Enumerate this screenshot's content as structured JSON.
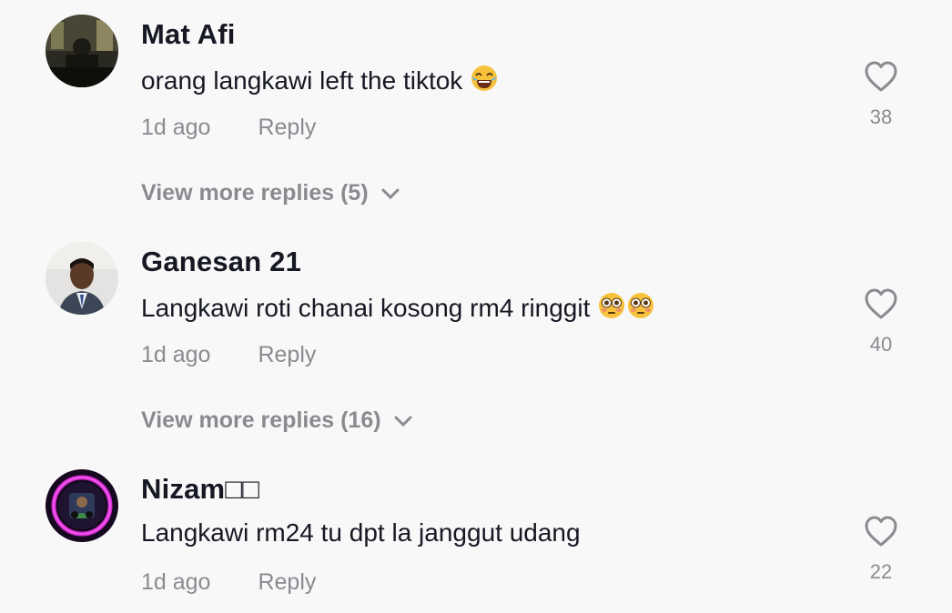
{
  "comments": [
    {
      "username": "Mat Afi",
      "text": "orang langkawi left the tiktok ",
      "emoji": [
        "tears-of-joy"
      ],
      "time": "1d ago",
      "reply_label": "Reply",
      "likes": "38",
      "more_replies": "View more replies (5)"
    },
    {
      "username": "Ganesan 21",
      "text": "Langkawi roti chanai kosong rm4 ringgit ",
      "emoji": [
        "flushed",
        "flushed"
      ],
      "time": "1d ago",
      "reply_label": "Reply",
      "likes": "40",
      "more_replies": "View more replies (16)"
    },
    {
      "username": "Nizam",
      "username_suffix": "□□",
      "text": "Langkawi rm24 tu dpt la janggut udang",
      "time": "1d ago",
      "reply_label": "Reply",
      "likes": "22"
    }
  ],
  "colors": {
    "background": "#f8f8f8",
    "primary_text": "#161823",
    "secondary_text": "#8a8b91"
  }
}
